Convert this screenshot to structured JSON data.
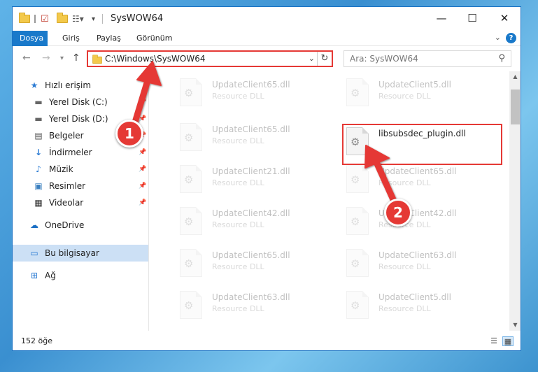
{
  "window": {
    "title": "SysWOW64",
    "ribbon_tabs": [
      {
        "label": "Dosya",
        "active": true
      },
      {
        "label": "Giriş",
        "active": false
      },
      {
        "label": "Paylaş",
        "active": false
      },
      {
        "label": "Görünüm",
        "active": false
      }
    ],
    "help_label": "?"
  },
  "address": {
    "path": "C:\\Windows\\SysWOW64",
    "search_placeholder": "Ara: SysWOW64"
  },
  "nav": {
    "items": [
      {
        "label": "Hızlı erişim",
        "icon": "star-icon",
        "pinned": false,
        "selected": false
      },
      {
        "label": "Yerel Disk (C:)",
        "icon": "drive-icon",
        "pinned": true,
        "selected": false
      },
      {
        "label": "Yerel Disk (D:)",
        "icon": "drive-icon",
        "pinned": true,
        "selected": false
      },
      {
        "label": "Belgeler",
        "icon": "documents-icon",
        "pinned": true,
        "selected": false
      },
      {
        "label": "İndirmeler",
        "icon": "download-icon",
        "pinned": true,
        "selected": false
      },
      {
        "label": "Müzik",
        "icon": "music-icon",
        "pinned": true,
        "selected": false
      },
      {
        "label": "Resimler",
        "icon": "pictures-icon",
        "pinned": true,
        "selected": false
      },
      {
        "label": "Videolar",
        "icon": "videos-icon",
        "pinned": true,
        "selected": false
      },
      {
        "label": "OneDrive",
        "icon": "cloud-icon",
        "pinned": false,
        "selected": false
      },
      {
        "label": "Bu bilgisayar",
        "icon": "computer-icon",
        "pinned": false,
        "selected": true
      },
      {
        "label": "Ağ",
        "icon": "network-icon",
        "pinned": false,
        "selected": false
      }
    ]
  },
  "files": {
    "left": [
      {
        "name": "UpdateClient65.dll",
        "type": "Resource DLL"
      },
      {
        "name": "UpdateClient65.dll",
        "type": "Resource DLL"
      },
      {
        "name": "UpdateClient21.dll",
        "type": "Resource DLL"
      },
      {
        "name": "UpdateClient42.dll",
        "type": "Resource DLL"
      },
      {
        "name": "UpdateClient65.dll",
        "type": "Resource DLL"
      },
      {
        "name": "UpdateClient63.dll",
        "type": "Resource DLL"
      }
    ],
    "right": [
      {
        "name": "UpdateClient5.dll",
        "type": "Resource DLL"
      },
      {
        "name": "libsubsdec_plugin.dll",
        "type": "",
        "highlighted": true
      },
      {
        "name": "UpdateClient65.dll",
        "type": "Resource DLL"
      },
      {
        "name": "UpdateClient42.dll",
        "type": "Resource DLL"
      },
      {
        "name": "UpdateClient63.dll",
        "type": "Resource DLL"
      },
      {
        "name": "UpdateClient5.dll",
        "type": "Resource DLL"
      }
    ]
  },
  "status": {
    "item_count": "152 öğe"
  },
  "annotations": {
    "step1": "1",
    "step2": "2",
    "color": "#e53935"
  }
}
